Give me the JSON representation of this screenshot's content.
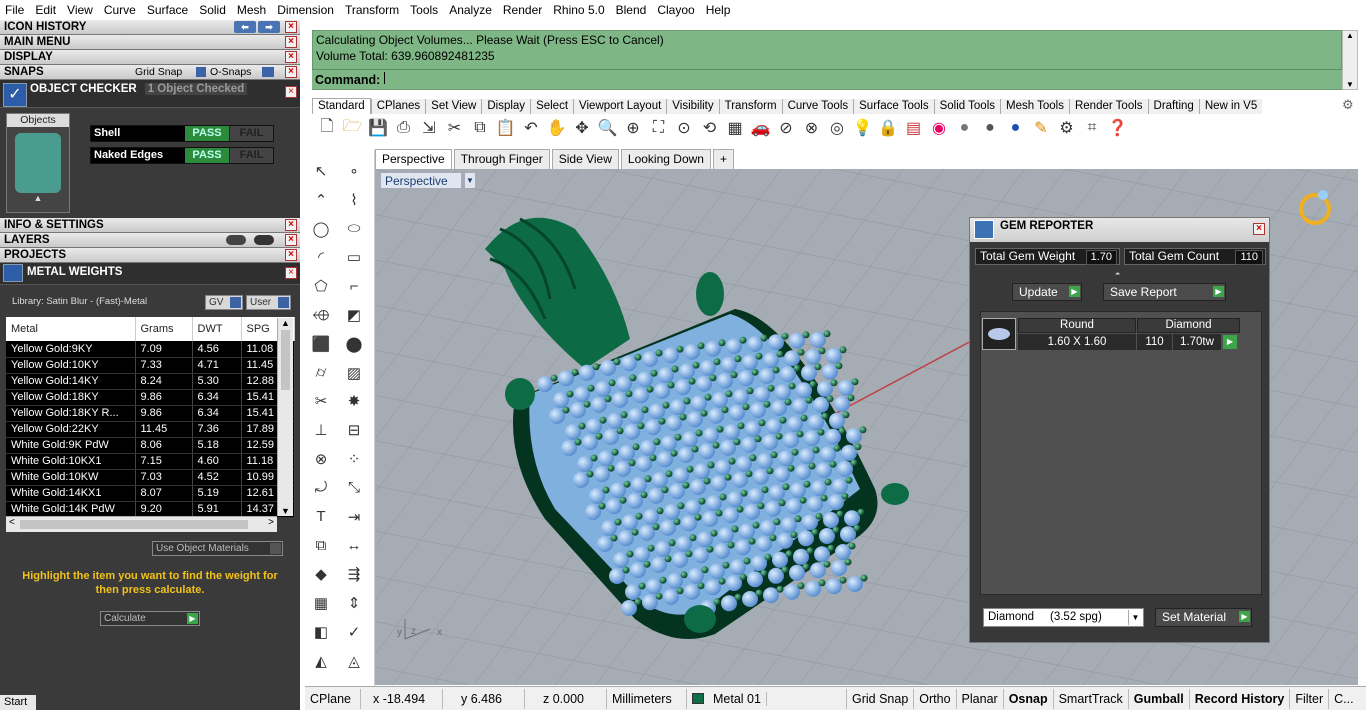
{
  "menubar": [
    "File",
    "Edit",
    "View",
    "Curve",
    "Surface",
    "Solid",
    "Mesh",
    "Dimension",
    "Transform",
    "Tools",
    "Analyze",
    "Render",
    "Rhino 5.0",
    "Blend",
    "Clayoo",
    "Help"
  ],
  "left": {
    "icon_history": "ICON HISTORY",
    "main_menu": "MAIN MENU",
    "display": "DISPLAY",
    "snaps": "SNAPS",
    "grid_snap": "Grid Snap",
    "o_snaps": "O-Snaps",
    "object_checker": "OBJECT CHECKER",
    "objects_checked": "1  Object Checked",
    "objects_tab": "Objects",
    "checks": [
      {
        "name": "Shell",
        "pass": "PASS",
        "fail": "FAIL"
      },
      {
        "name": "Naked Edges",
        "pass": "PASS",
        "fail": "FAIL"
      }
    ],
    "info_settings": "INFO & SETTINGS",
    "layers": "LAYERS",
    "projects": "PROJECTS",
    "metal_weights": "METAL WEIGHTS",
    "library": "Library: Satin Blur - (Fast)-Metal",
    "gv": "GV",
    "user": "User",
    "columns": [
      "Metal",
      "Grams",
      "DWT",
      "SPG"
    ],
    "rows": [
      [
        "Yellow Gold:9KY",
        "7.09",
        "4.56",
        "11.08"
      ],
      [
        "Yellow Gold:10KY",
        "7.33",
        "4.71",
        "11.45"
      ],
      [
        "Yellow Gold:14KY",
        "8.24",
        "5.30",
        "12.88"
      ],
      [
        "Yellow Gold:18KY",
        "9.86",
        "6.34",
        "15.41"
      ],
      [
        "Yellow Gold:18KY R...",
        "9.86",
        "6.34",
        "15.41"
      ],
      [
        "Yellow Gold:22KY",
        "11.45",
        "7.36",
        "17.89"
      ],
      [
        "White Gold:9K PdW",
        "8.06",
        "5.18",
        "12.59"
      ],
      [
        "White Gold:10KX1",
        "7.15",
        "4.60",
        "11.18"
      ],
      [
        "White Gold:10KW",
        "7.03",
        "4.52",
        "10.99"
      ],
      [
        "White Gold:14KX1",
        "8.07",
        "5.19",
        "12.61"
      ],
      [
        "White Gold:14K PdW",
        "9.20",
        "5.91",
        "14.37"
      ]
    ],
    "use_object_materials": "Use Object Materials",
    "hint": "Highlight the item you want to find the weight for then press calculate.",
    "calculate": "Calculate",
    "start": "Start"
  },
  "command": {
    "line1": "Calculating Object Volumes... Please Wait (Press ESC to Cancel)",
    "line2": "Volume Total: 639.960892481235",
    "prompt": "Command:"
  },
  "toolbar_tabs": [
    "Standard",
    "CPlanes",
    "Set View",
    "Display",
    "Select",
    "Viewport Layout",
    "Visibility",
    "Transform",
    "Curve Tools",
    "Surface Tools",
    "Solid Tools",
    "Mesh Tools",
    "Render Tools",
    "Drafting",
    "New in V5"
  ],
  "viewport_tabs": [
    "Perspective",
    "Through Finger",
    "Side View",
    "Looking Down",
    "+"
  ],
  "viewport_label": "Perspective",
  "gem": {
    "title": "GEM REPORTER",
    "total_weight_label": "Total Gem Weight",
    "total_weight": "1.70",
    "total_count_label": "Total Gem Count",
    "total_count": "110",
    "update": "Update",
    "save_report": "Save Report",
    "col_shape": "Round",
    "col_material": "Diamond",
    "size": "1.60 X 1.60",
    "count": "110",
    "tw": "1.70tw",
    "material_select": "Diamond     (3.52 spg)",
    "set_material": "Set Material"
  },
  "status": {
    "cplane": "CPlane",
    "x": "x -18.494",
    "y": "y 6.486",
    "z": "z 0.000",
    "units": "Millimeters",
    "layer": "Metal 01",
    "grid_snap": "Grid Snap",
    "ortho": "Ortho",
    "planar": "Planar",
    "osnap": "Osnap",
    "smarttrack": "SmartTrack",
    "gumball": "Gumball",
    "record_history": "Record History",
    "filter": "Filter",
    "more": "C..."
  },
  "colors": {
    "metal": "#0e6e46",
    "gem": "#8fb8e8",
    "command_bg": "#7fb685",
    "pass": "#2c8a3c"
  }
}
